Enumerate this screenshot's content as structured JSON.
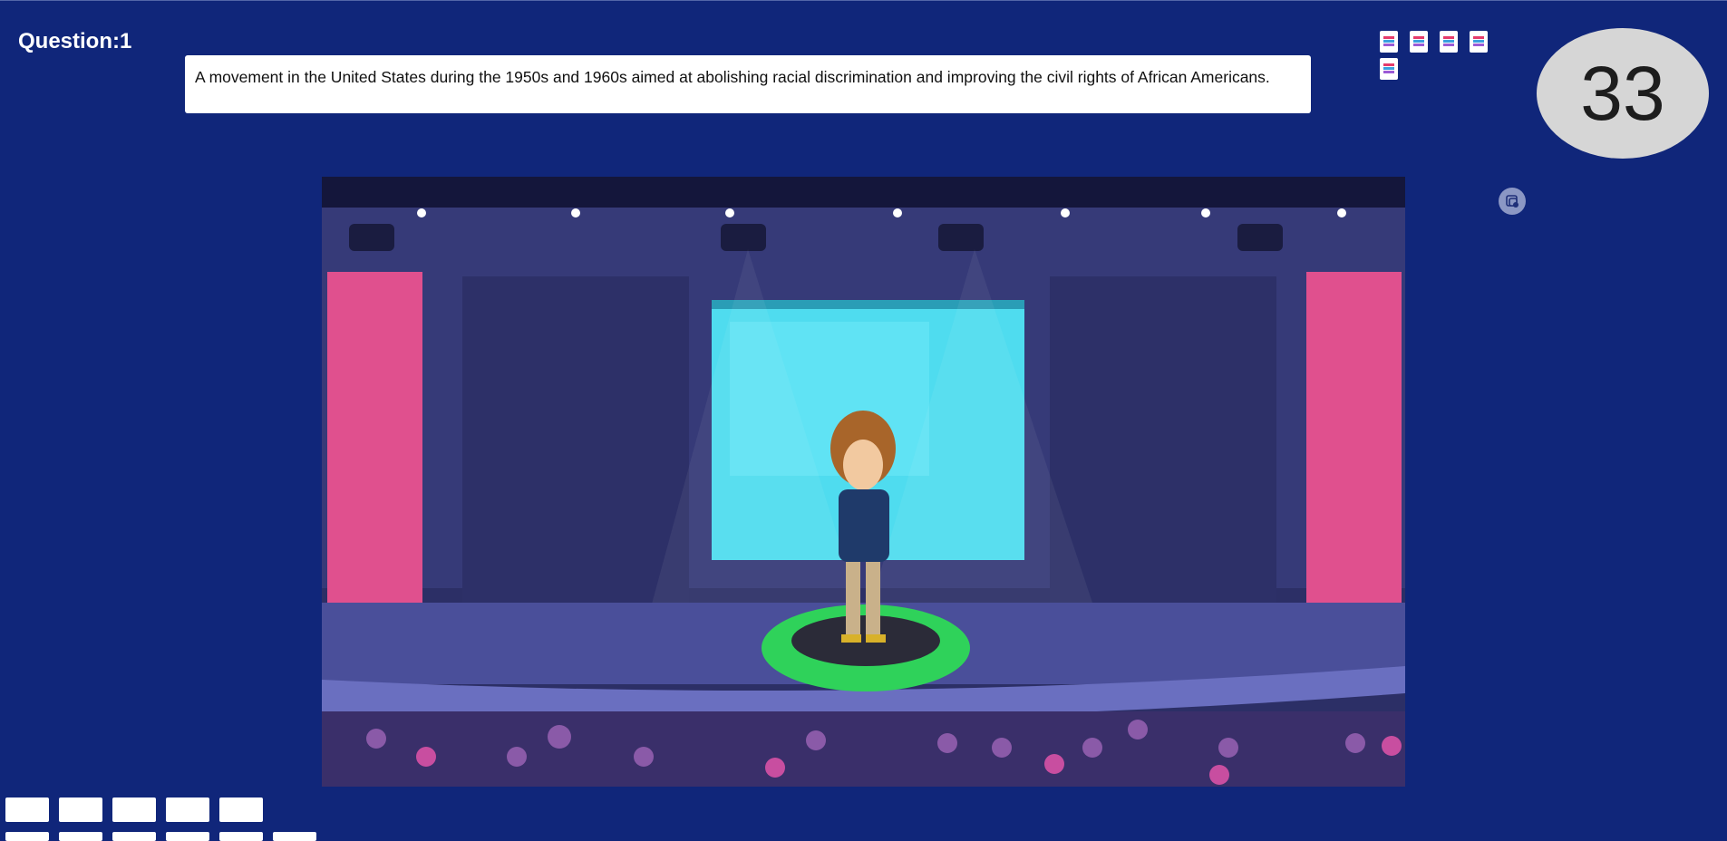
{
  "question": {
    "label": "Question:1",
    "text": "A movement in the United States during the 1950s and 1960s aimed at abolishing racial discrimination and improving the civil rights of African Americans."
  },
  "timer": {
    "value": "33"
  },
  "lifelines": [
    {
      "icon": "lifeline-icon"
    },
    {
      "icon": "lifeline-icon"
    },
    {
      "icon": "lifeline-icon"
    },
    {
      "icon": "lifeline-icon"
    },
    {
      "icon": "lifeline-icon"
    }
  ],
  "colors": {
    "background": "#10267a",
    "timer_bg": "#d6d6d6",
    "stage_platform": "#2fd25a",
    "stage_screen": "#4fdcef",
    "side_panels": "#e0508e"
  },
  "stage": {
    "character": "host-character",
    "scene": "game-show-stage"
  },
  "answer_tiles_count": 10
}
